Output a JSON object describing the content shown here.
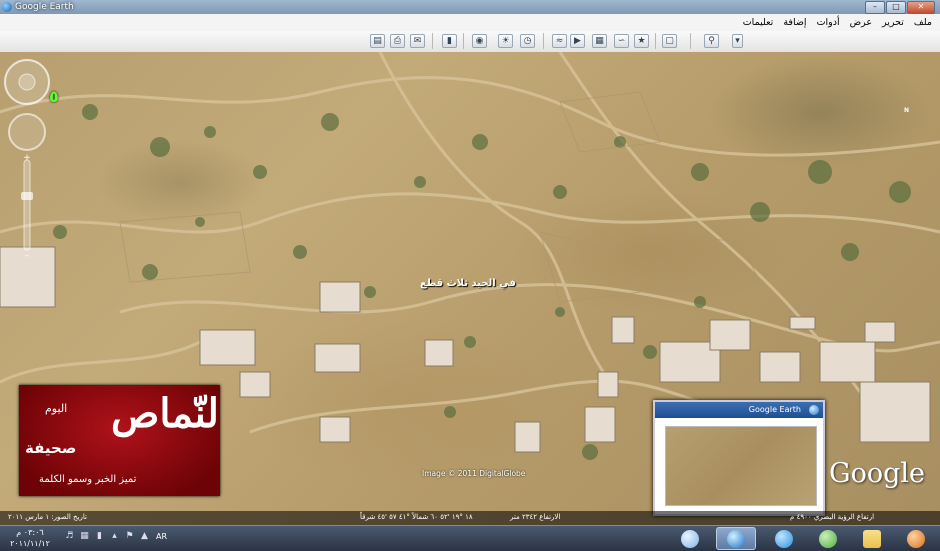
{
  "window": {
    "title": "Google Earth",
    "controls": [
      "minimize",
      "maximize",
      "close"
    ]
  },
  "menu": [
    "ملف",
    "تحرير",
    "عرض",
    "أدوات",
    "إضافة",
    "تعليمات"
  ],
  "toolbar": {
    "icons": [
      "sidebar-icon",
      "placemark-icon",
      "polygon-icon",
      "path-icon",
      "overlay-icon",
      "tour-icon",
      "history-icon",
      "sun-icon",
      "planets-icon",
      "ruler-icon",
      "email-icon",
      "print-icon",
      "map-view-icon",
      "search-icon"
    ]
  },
  "map": {
    "marker_label": "٥",
    "place_label": "في الحيد ثلاث قطع",
    "image_credit": "Image © 2011 DigitalGlobe",
    "logo_text": "Google",
    "navigation": {
      "north_label": "N"
    }
  },
  "overview_map": {
    "title": "Google Earth"
  },
  "watermark": {
    "today": "اليوم",
    "main": "النّماص",
    "paper": "صحيفة",
    "slogan": "تميز الخبر وسمو الكلمة"
  },
  "status_bar": {
    "left_text": "تاريخ الصور: ١ مارس ٢٠١١",
    "coords_text": "١٨ °١٩ '٥٢ ٦٠ شمالاً   °٤١ ٥٧ '٤٥ شرقاً",
    "elevation_text": "الارتفاع ٢٣٤٢ متر",
    "eye_text": "ارتفاع الرؤية البصري ٤٩٠٠ م"
  },
  "taskbar": {
    "clock_time": "٠٣:٠٦ م",
    "clock_date": "٢٠١١/١١/١٢",
    "language": "AR",
    "tray_icons": [
      "chevron-up-icon",
      "volume-icon",
      "network-icon",
      "signal-icon",
      "battery-icon",
      "flag-icon"
    ],
    "apps": [
      {
        "name": "paint-app",
        "color": "#7fb2e5"
      },
      {
        "name": "google-earth-app",
        "color": "#1f6fc9",
        "active": true
      },
      {
        "name": "internet-explorer-app",
        "color": "#2a8fe0"
      },
      {
        "name": "messenger-app",
        "color": "#4fae3e"
      },
      {
        "name": "explorer-app",
        "color": "#e8c14a"
      },
      {
        "name": "media-player-app",
        "color": "#d96f1a"
      }
    ]
  }
}
